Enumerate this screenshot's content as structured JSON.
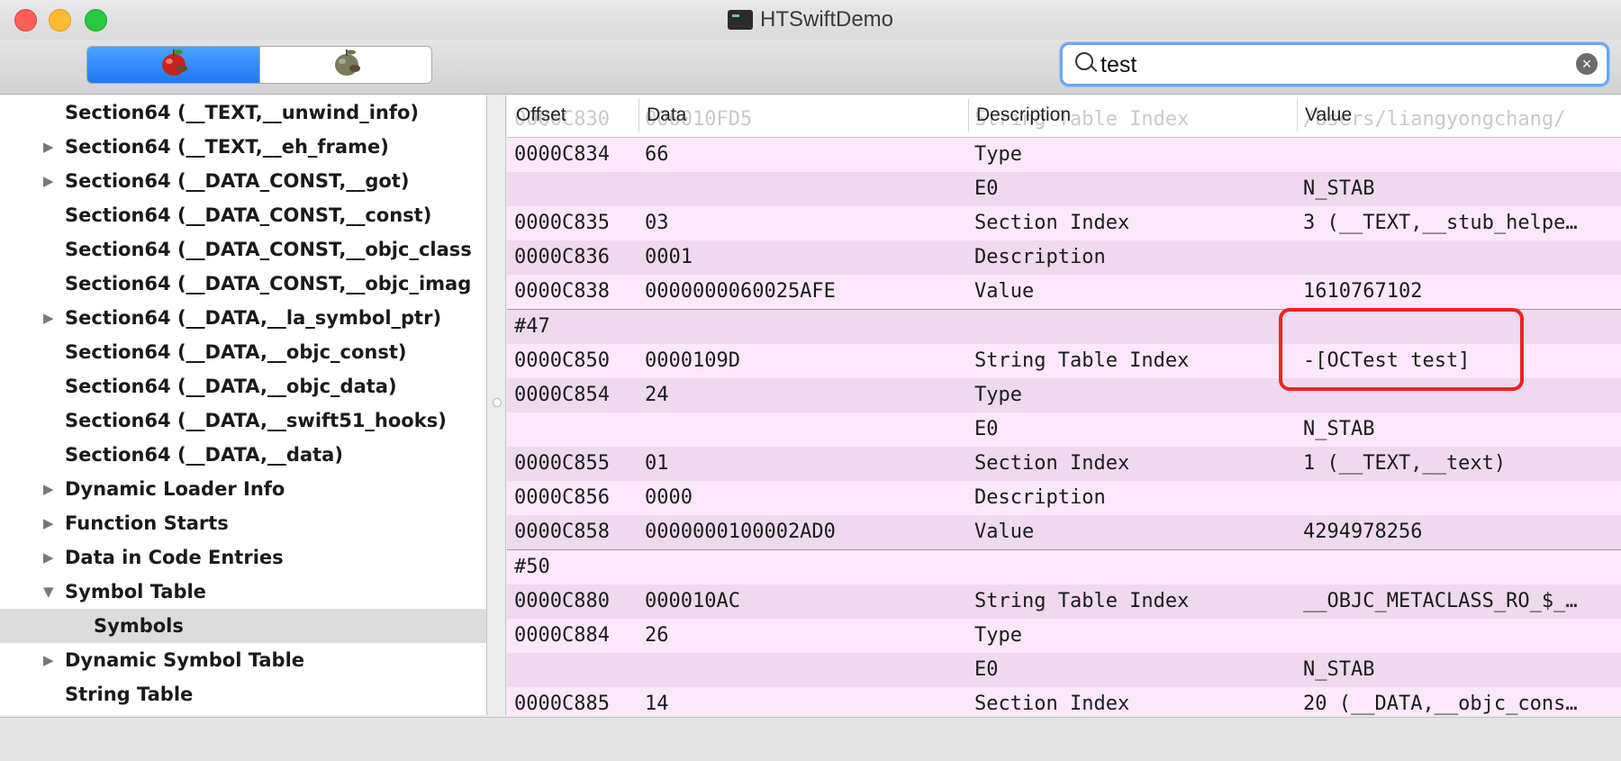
{
  "window": {
    "title": "HTSwiftDemo"
  },
  "toolbar": {
    "segments": [
      {
        "icon": "apple-bug-icon-red"
      },
      {
        "icon": "apple-bug-icon-gray"
      }
    ],
    "search": {
      "value": "test",
      "clear_icon": "×"
    }
  },
  "sidebar": {
    "items": [
      {
        "label": "Section64 (__TEXT,__unwind_info)",
        "disclosure": ""
      },
      {
        "label": "Section64 (__TEXT,__eh_frame)",
        "disclosure": "▶"
      },
      {
        "label": "Section64 (__DATA_CONST,__got)",
        "disclosure": "▶"
      },
      {
        "label": "Section64 (__DATA_CONST,__const)",
        "disclosure": ""
      },
      {
        "label": "Section64 (__DATA_CONST,__objc_class",
        "disclosure": ""
      },
      {
        "label": "Section64 (__DATA_CONST,__objc_imag",
        "disclosure": ""
      },
      {
        "label": "Section64 (__DATA,__la_symbol_ptr)",
        "disclosure": "▶"
      },
      {
        "label": "Section64 (__DATA,__objc_const)",
        "disclosure": ""
      },
      {
        "label": "Section64 (__DATA,__objc_data)",
        "disclosure": ""
      },
      {
        "label": "Section64 (__DATA,__swift51_hooks)",
        "disclosure": ""
      },
      {
        "label": "Section64 (__DATA,__data)",
        "disclosure": ""
      },
      {
        "label": "Dynamic Loader Info",
        "disclosure": "▶"
      },
      {
        "label": "Function Starts",
        "disclosure": "▶"
      },
      {
        "label": "Data in Code Entries",
        "disclosure": "▶"
      },
      {
        "label": "Symbol Table",
        "disclosure": "▼"
      },
      {
        "label": "Symbols",
        "disclosure": ""
      },
      {
        "label": "Dynamic Symbol Table",
        "disclosure": "▶"
      },
      {
        "label": "String Table",
        "disclosure": ""
      }
    ]
  },
  "table": {
    "headers": {
      "offset": "Offset",
      "data": "Data",
      "description": "Description",
      "value": "Value"
    },
    "ghost": {
      "offset": "0000C830",
      "data": "000010FD5",
      "description": "String Table Index",
      "value": "/Users/liangyongchang/"
    },
    "rows": [
      {
        "offset": "0000C834",
        "data": "66",
        "description": "Type",
        "value": ""
      },
      {
        "offset": "",
        "data": "",
        "description": "E0",
        "value": "N_STAB"
      },
      {
        "offset": "0000C835",
        "data": "03",
        "description": "Section Index",
        "value": "3 (__TEXT,__stub_helpe…"
      },
      {
        "offset": "0000C836",
        "data": "0001",
        "description": "Description",
        "value": ""
      },
      {
        "offset": "0000C838",
        "data": "0000000060025AFE",
        "description": "Value",
        "value": "1610767102"
      },
      {
        "offset": "#47",
        "data": "",
        "description": "",
        "value": ""
      },
      {
        "offset": "0000C850",
        "data": "0000109D",
        "description": "String Table Index",
        "value": "-[OCTest test]"
      },
      {
        "offset": "0000C854",
        "data": "24",
        "description": "Type",
        "value": ""
      },
      {
        "offset": "",
        "data": "",
        "description": "E0",
        "value": "N_STAB"
      },
      {
        "offset": "0000C855",
        "data": "01",
        "description": "Section Index",
        "value": "1 (__TEXT,__text)"
      },
      {
        "offset": "0000C856",
        "data": "0000",
        "description": "Description",
        "value": ""
      },
      {
        "offset": "0000C858",
        "data": "0000000100002AD0",
        "description": "Value",
        "value": "4294978256"
      },
      {
        "offset": "#50",
        "data": "",
        "description": "",
        "value": ""
      },
      {
        "offset": "0000C880",
        "data": "000010AC",
        "description": "String Table Index",
        "value": "__OBJC_METACLASS_RO_$_…"
      },
      {
        "offset": "0000C884",
        "data": "26",
        "description": "Type",
        "value": ""
      },
      {
        "offset": "",
        "data": "",
        "description": "E0",
        "value": "N_STAB"
      },
      {
        "offset": "0000C885",
        "data": "14",
        "description": "Section Index",
        "value": "20 (__DATA,__objc_cons…"
      }
    ]
  }
}
